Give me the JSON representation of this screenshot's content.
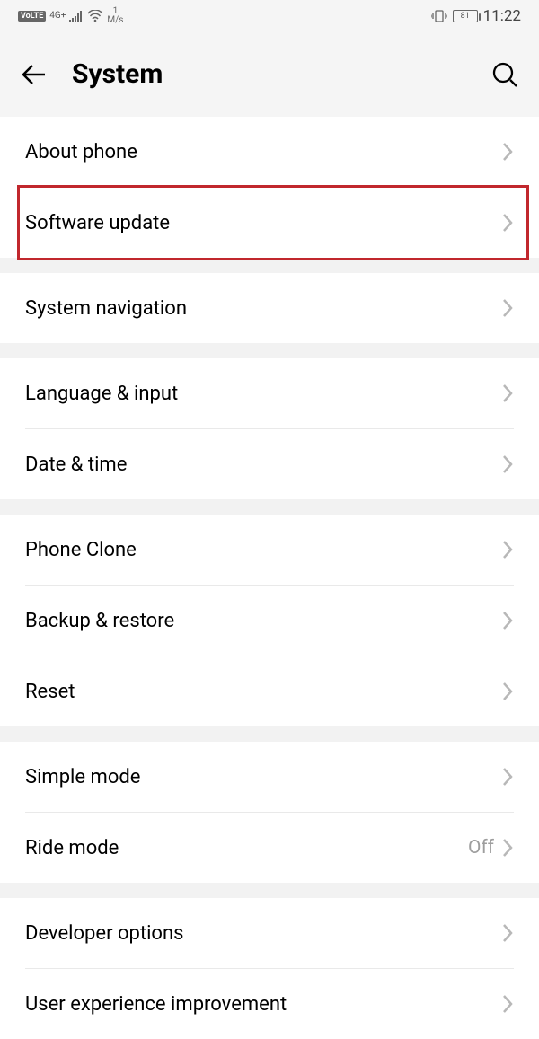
{
  "statusBar": {
    "volte": "VoLTE",
    "network": "4G+",
    "speed_value": "1",
    "speed_unit": "M/s",
    "battery": "81",
    "time": "11:22"
  },
  "header": {
    "title": "System"
  },
  "groups": [
    {
      "items": [
        {
          "label": "About phone",
          "highlighted": false
        },
        {
          "label": "Software update",
          "highlighted": true
        }
      ]
    },
    {
      "items": [
        {
          "label": "System navigation"
        }
      ]
    },
    {
      "items": [
        {
          "label": "Language & input"
        },
        {
          "label": "Date & time"
        }
      ]
    },
    {
      "items": [
        {
          "label": "Phone Clone"
        },
        {
          "label": "Backup & restore"
        },
        {
          "label": "Reset"
        }
      ]
    },
    {
      "items": [
        {
          "label": "Simple mode"
        },
        {
          "label": "Ride mode",
          "value": "Off"
        }
      ]
    },
    {
      "items": [
        {
          "label": "Developer options"
        },
        {
          "label": "User experience improvement"
        }
      ]
    }
  ]
}
